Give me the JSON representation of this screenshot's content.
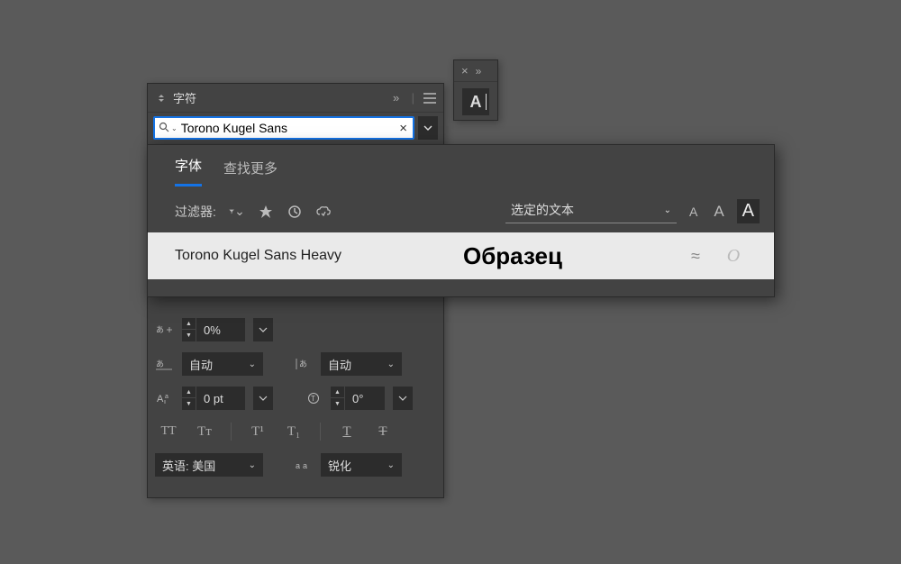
{
  "panel": {
    "title": "字符"
  },
  "search": {
    "value": "Torono Kugel Sans"
  },
  "tabs": {
    "font": "字体",
    "findMore": "查找更多"
  },
  "filter": {
    "label": "过滤器:",
    "selectedText": "选定的文本"
  },
  "result": {
    "name": "Torono Kugel Sans Heavy",
    "sample": "Образец",
    "approx": "≈",
    "italic": "O"
  },
  "controls": {
    "tracking": "0%",
    "kerningLeft": "自动",
    "kerningRight": "自动",
    "baseline": "0 pt",
    "rotation": "0°",
    "language": "英语: 美国",
    "antialias": "锐化"
  },
  "format": {
    "tt_caps": "TT",
    "tt_small": "Tᴛ",
    "sup": "T¹",
    "sub": "T₁",
    "underline": "T",
    "strike": "T"
  }
}
